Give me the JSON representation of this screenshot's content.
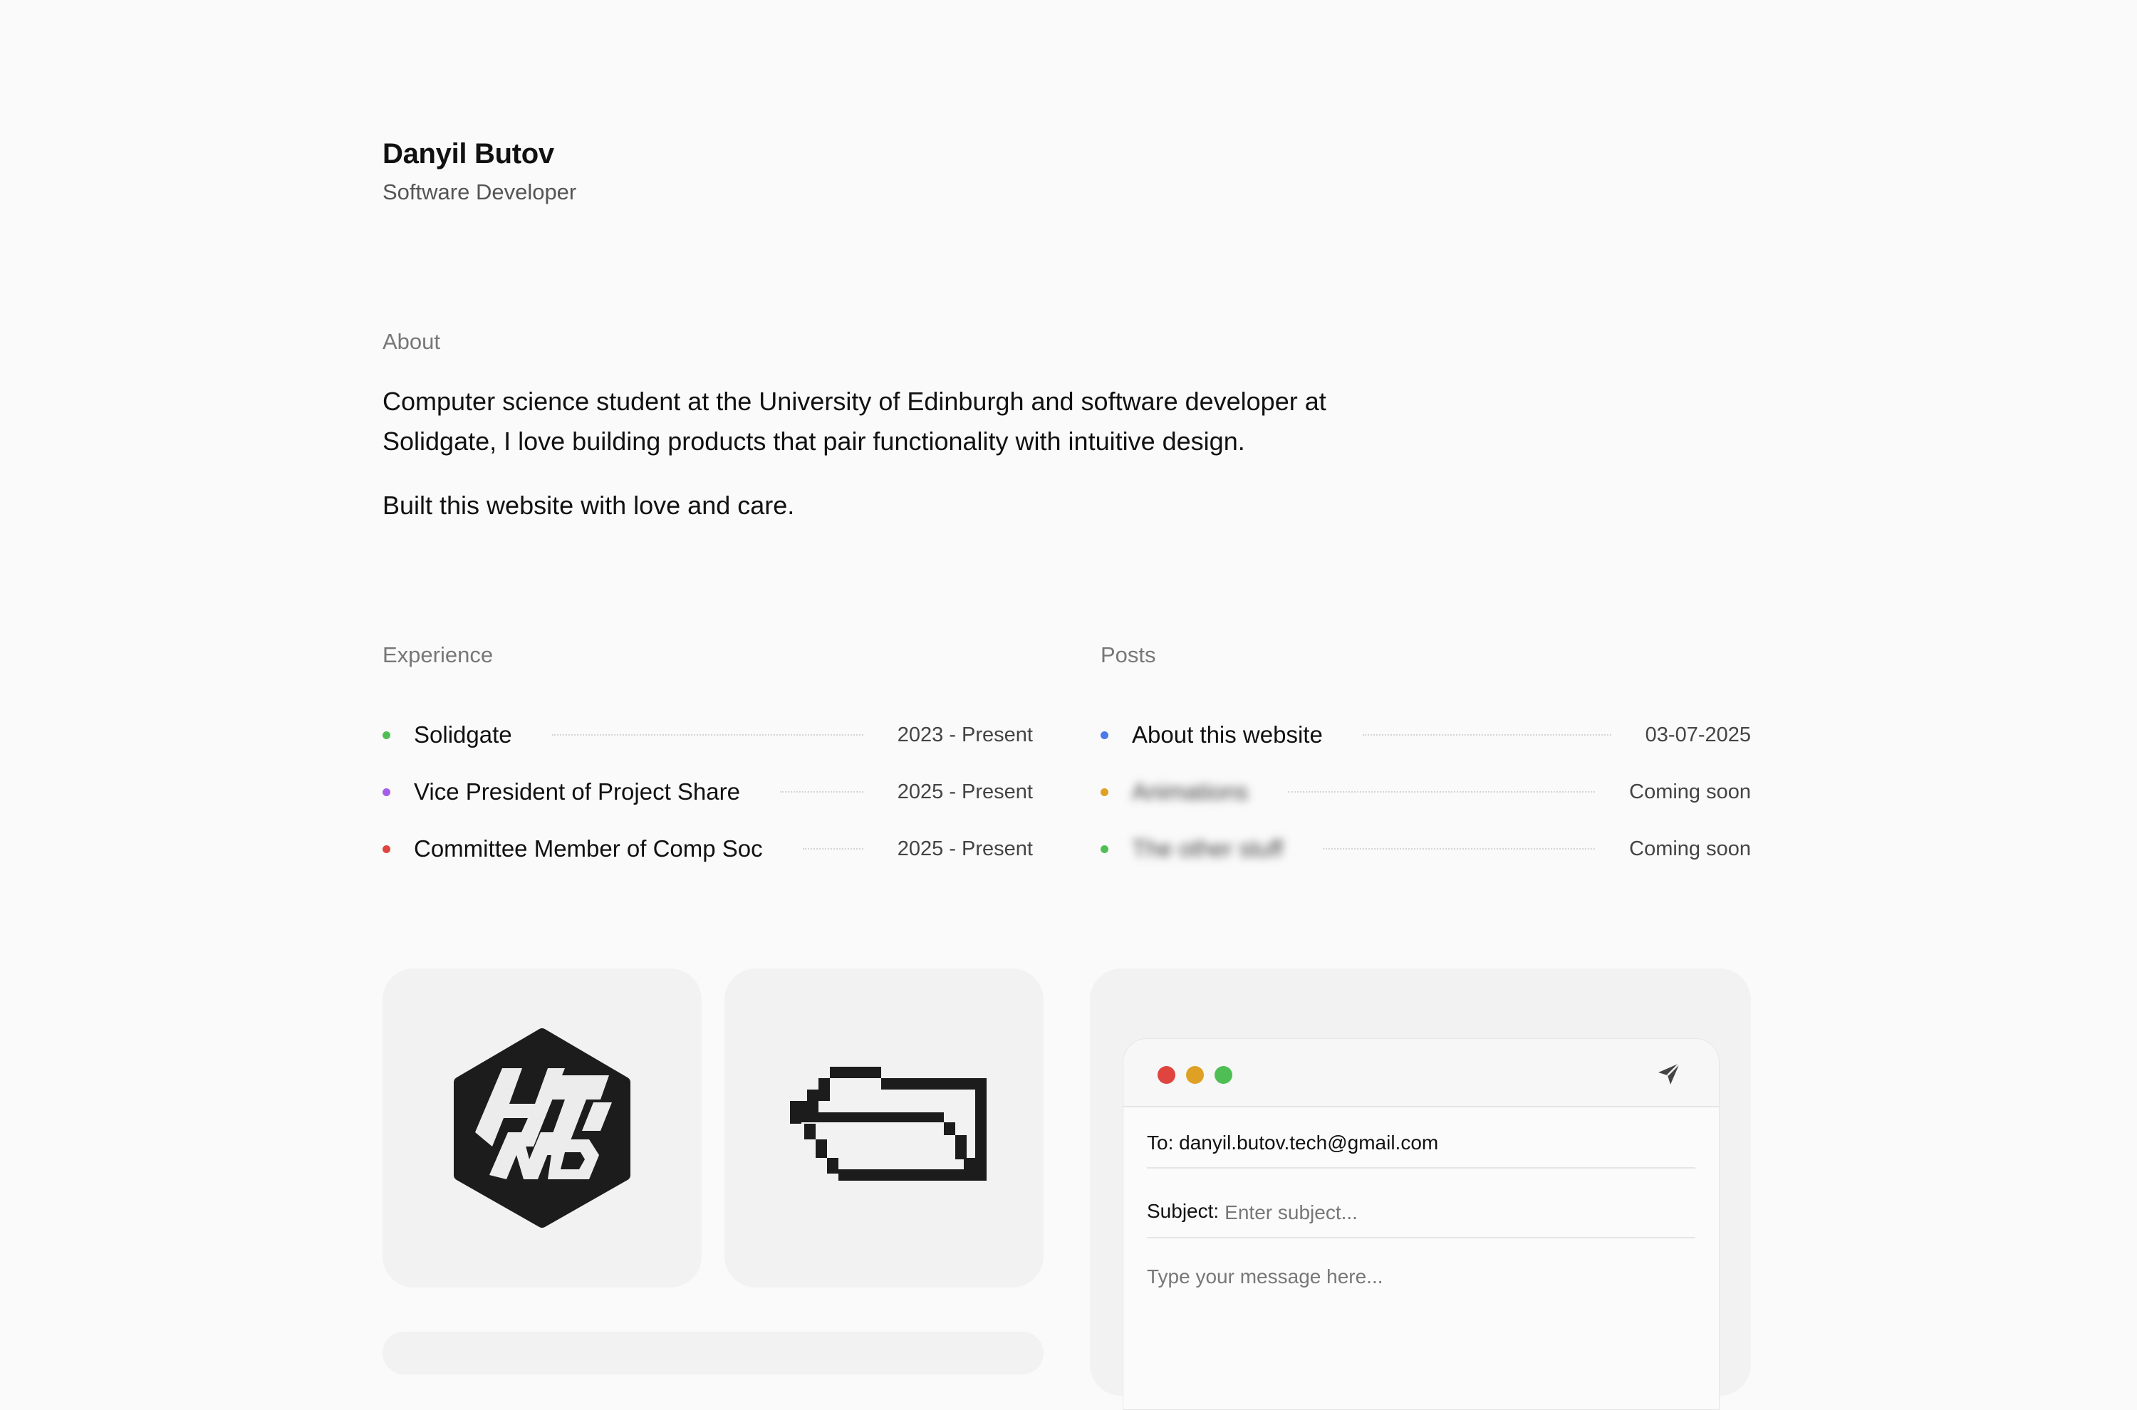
{
  "profile": {
    "name": "Danyil Butov",
    "role": "Software Developer"
  },
  "about": {
    "label": "About",
    "paragraph1": "Computer science student at the University of Edinburgh and software developer at Solidgate, I love building products that pair functionality with intuitive design.",
    "paragraph2": "Built this website with love and care."
  },
  "experience": {
    "label": "Experience",
    "items": [
      {
        "title": "Solidgate",
        "period": "2023 - Present",
        "dot_color": "#4fbf55"
      },
      {
        "title": "Vice President of Project Share",
        "period": "2025 - Present",
        "dot_color": "#a55ee8"
      },
      {
        "title": "Committee Member of Comp Soc",
        "period": "2025 - Present",
        "dot_color": "#e0443e"
      }
    ]
  },
  "posts": {
    "label": "Posts",
    "items": [
      {
        "title": "About this website",
        "date": "03-07-2025",
        "dot_color": "#4a7be8"
      },
      {
        "title": "Animations",
        "date": "Coming soon",
        "dot_color": "#dea123"
      },
      {
        "title": "The other stuff",
        "date": "Coming soon",
        "dot_color": "#4fbf55"
      }
    ]
  },
  "cards": {
    "logo1_icon": "hex-monogram-icon",
    "logo2_icon": "pixel-folder-icon"
  },
  "mail": {
    "to_label": "To:",
    "to_value": "danyil.butov.tech@gmail.com",
    "subject_label": "Subject:",
    "subject_placeholder": "Enter subject...",
    "body_placeholder": "Type your message here...",
    "send_icon": "send-icon"
  }
}
